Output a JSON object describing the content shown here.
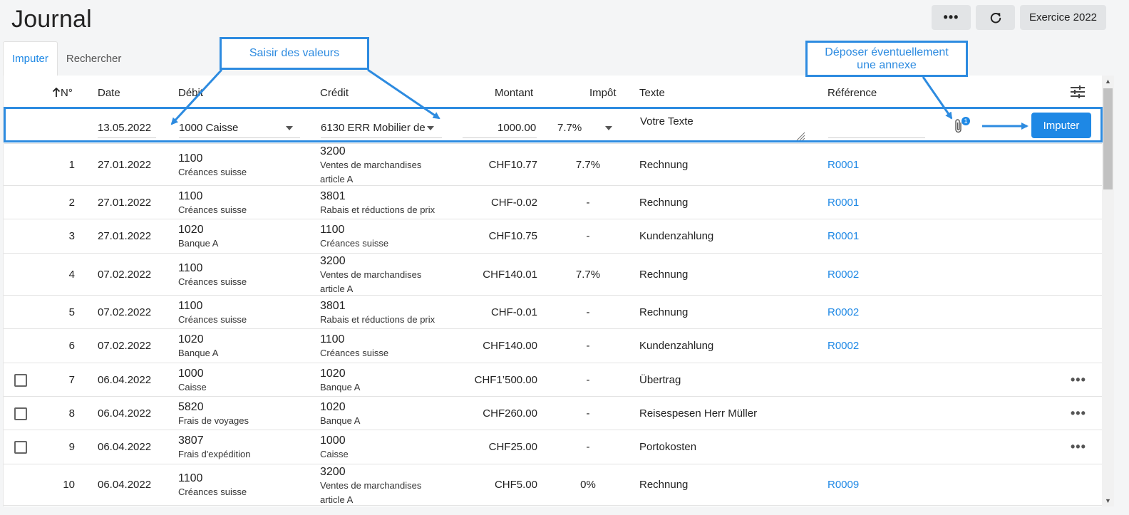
{
  "header": {
    "title": "Journal",
    "more_label": "•••",
    "year_label": "Exercice 2022"
  },
  "tabs": [
    {
      "label": "Imputer",
      "active": true
    },
    {
      "label": "Rechercher",
      "active": false
    }
  ],
  "columns": {
    "no": "N°",
    "date": "Date",
    "debit": "Débit",
    "credit": "Crédit",
    "amount": "Montant",
    "tax": "Impôt",
    "text": "Texte",
    "reference": "Référence"
  },
  "entry": {
    "date": "13.05.2022",
    "debit": "1000 Caisse",
    "credit": "6130 ERR Mobilier de",
    "amount": "1000.00",
    "tax": "7.7%",
    "text": "Votre Texte",
    "attachment_count": "1",
    "submit_label": "Imputer"
  },
  "rows": [
    {
      "no": "1",
      "date": "27.01.2022",
      "debit_num": "1100",
      "debit_name": "Créances suisse",
      "credit_num": "3200",
      "credit_name": "Ventes de marchandises article A",
      "amount": "CHF10.77",
      "tax": "7.7%",
      "text": "Rechnung",
      "ref": "R0001",
      "checkbox": false
    },
    {
      "no": "2",
      "date": "27.01.2022",
      "debit_num": "1100",
      "debit_name": "Créances suisse",
      "credit_num": "3801",
      "credit_name": "Rabais et réductions de prix",
      "amount": "CHF-0.02",
      "tax": "-",
      "text": "Rechnung",
      "ref": "R0001",
      "checkbox": false
    },
    {
      "no": "3",
      "date": "27.01.2022",
      "debit_num": "1020",
      "debit_name": "Banque A",
      "credit_num": "1100",
      "credit_name": "Créances suisse",
      "amount": "CHF10.75",
      "tax": "-",
      "text": "Kundenzahlung",
      "ref": "R0001",
      "checkbox": false
    },
    {
      "no": "4",
      "date": "07.02.2022",
      "debit_num": "1100",
      "debit_name": "Créances suisse",
      "credit_num": "3200",
      "credit_name": "Ventes de marchandises article A",
      "amount": "CHF140.01",
      "tax": "7.7%",
      "text": "Rechnung",
      "ref": "R0002",
      "checkbox": false
    },
    {
      "no": "5",
      "date": "07.02.2022",
      "debit_num": "1100",
      "debit_name": "Créances suisse",
      "credit_num": "3801",
      "credit_name": "Rabais et réductions de prix",
      "amount": "CHF-0.01",
      "tax": "-",
      "text": "Rechnung",
      "ref": "R0002",
      "checkbox": false
    },
    {
      "no": "6",
      "date": "07.02.2022",
      "debit_num": "1020",
      "debit_name": "Banque A",
      "credit_num": "1100",
      "credit_name": "Créances suisse",
      "amount": "CHF140.00",
      "tax": "-",
      "text": "Kundenzahlung",
      "ref": "R0002",
      "checkbox": false
    },
    {
      "no": "7",
      "date": "06.04.2022",
      "debit_num": "1000",
      "debit_name": "Caisse",
      "credit_num": "1020",
      "credit_name": "Banque A",
      "amount": "CHF1’500.00",
      "tax": "-",
      "text": "Übertrag",
      "ref": "",
      "checkbox": true
    },
    {
      "no": "8",
      "date": "06.04.2022",
      "debit_num": "5820",
      "debit_name": "Frais de voyages",
      "credit_num": "1020",
      "credit_name": "Banque A",
      "amount": "CHF260.00",
      "tax": "-",
      "text": "Reisespesen Herr Müller",
      "ref": "",
      "checkbox": true
    },
    {
      "no": "9",
      "date": "06.04.2022",
      "debit_num": "3807",
      "debit_name": "Frais d'expédition",
      "credit_num": "1000",
      "credit_name": "Caisse",
      "amount": "CHF25.00",
      "tax": "-",
      "text": "Portokosten",
      "ref": "",
      "checkbox": true
    },
    {
      "no": "10",
      "date": "06.04.2022",
      "debit_num": "1100",
      "debit_name": "Créances suisse",
      "credit_num": "3200",
      "credit_name": "Ventes de marchandises article A",
      "amount": "CHF5.00",
      "tax": "0%",
      "text": "Rechnung",
      "ref": "R0009",
      "checkbox": false
    }
  ],
  "row_menu_label": "•••",
  "callouts": {
    "values": "Saisir des valeurs",
    "attachment": "Déposer éventuellement une annexe"
  },
  "colors": {
    "accent": "#1e88e5",
    "annotation": "#2d8be0"
  }
}
